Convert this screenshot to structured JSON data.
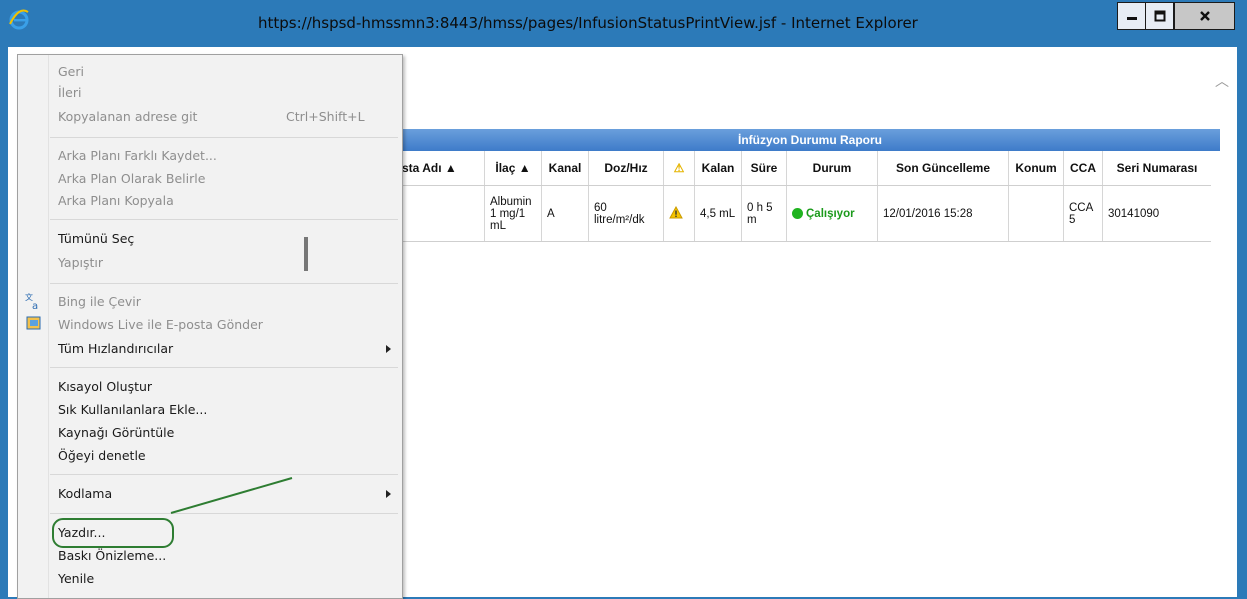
{
  "window": {
    "title": "https://hspsd-hmssmn3:8443/hmss/pages/InfusionStatusPrintView.jsf - Internet Explorer",
    "logo_icon": "internet-explorer-icon",
    "controls": [
      "minimize-icon",
      "maximize-icon",
      "close-icon"
    ]
  },
  "report": {
    "title": "İnfüzyon Durumu Raporu",
    "columns": [
      "sta Adı ▲",
      "İlaç ▲",
      "Kanal",
      "Doz/Hız",
      "⚠",
      "Kalan",
      "Süre",
      "Durum",
      "Son Güncelleme",
      "Konum",
      "CCA",
      "Seri Numarası"
    ],
    "row": {
      "patient": "",
      "drug": "Albumin 1 mg/1 mL",
      "channel": "A",
      "dose": "60 litre/m²/dk",
      "remaining": "4,5 mL",
      "duration": "0 h 5 m",
      "status": "Çalışıyor",
      "status_color": "#1fb31f",
      "last_update": "12/01/2016 15:28",
      "location": "",
      "cca": "CCA 5",
      "serial": "30141090"
    }
  },
  "context_menu": {
    "back": "Geri",
    "forward": "İleri",
    "paste_go": "Kopyalanan adrese git",
    "paste_go_shortcut": "Ctrl+Shift+L",
    "save_bg": "Arka Planı Farklı Kaydet...",
    "set_bg": "Arka Plan Olarak Belirle",
    "copy_bg": "Arka Planı Kopyala",
    "select_all": "Tümünü Seç",
    "paste": "Yapıştır",
    "bing": "Bing ile Çevir",
    "live_mail": "Windows Live ile E-posta Gönder",
    "accelerators": "Tüm Hızlandırıcılar",
    "shortcut": "Kısayol Oluştur",
    "favorites": "Sık Kullanılanlara Ekle...",
    "view_source": "Kaynağı Görüntüle",
    "inspect": "Öğeyi denetle",
    "encoding": "Kodlama",
    "print": "Yazdır...",
    "print_preview": "Baskı Önizleme...",
    "refresh": "Yenile"
  },
  "annotation": {
    "highlight_color": "#2e7d32"
  }
}
